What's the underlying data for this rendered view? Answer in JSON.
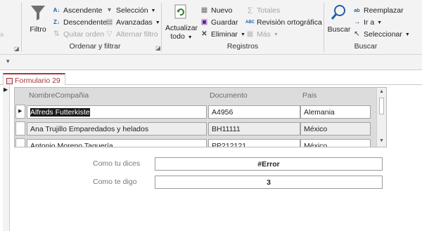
{
  "ribbon": {
    "filter_group": {
      "label": "Ordenar y filtrar",
      "filtro": "Filtro",
      "ascendente": "Ascendente",
      "descendente": "Descendente",
      "quitar_orden": "Quitar orden",
      "seleccion": "Selección",
      "avanzadas": "Avanzadas",
      "alternar_filtro": "Alternar filtro"
    },
    "records_group": {
      "label": "Registros",
      "actualizar_line1": "Actualizar",
      "actualizar_line2": "todo",
      "nuevo": "Nuevo",
      "guardar": "Guardar",
      "eliminar": "Eliminar",
      "totales": "Totales",
      "revision": "Revisión ortográfica",
      "mas": "Más"
    },
    "find_group": {
      "label": "Buscar",
      "buscar": "Buscar",
      "reemplazar": "Reemplazar",
      "ir_a": "Ir a",
      "seleccionar": "Seleccionar"
    }
  },
  "tab": {
    "label": "Formulario 29"
  },
  "datasheet": {
    "columns": [
      "NombreCompañia",
      "Documento",
      "Pais"
    ],
    "rows": [
      [
        "Alfreds Futterkiste",
        "A4956",
        "Alemania"
      ],
      [
        "Ana Trujillo Emparedados y helados",
        "BH11111",
        "México"
      ],
      [
        "Antonio Moreno Taquería",
        "PP212121",
        "México"
      ]
    ]
  },
  "form": {
    "field1_label": "Como tu dices",
    "field1_value": "#Error",
    "field2_label": "Como te digo",
    "field2_value": "3"
  },
  "colors": {
    "accent": "#a4373a",
    "find_icon": "#1f5ea8",
    "refresh_icon": "#2e7d32",
    "delete_icon": "#c62828"
  }
}
